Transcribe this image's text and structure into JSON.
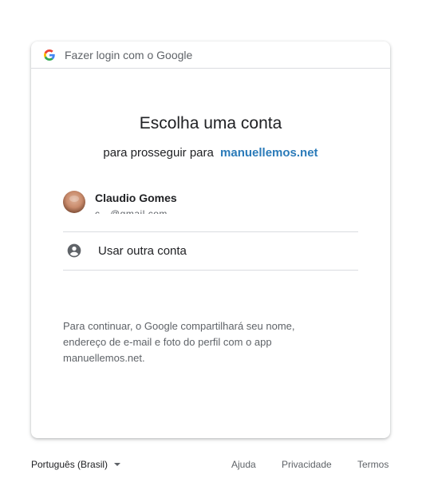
{
  "header": {
    "title": "Fazer login com o Google",
    "icon": "google-g-icon"
  },
  "main": {
    "title": "Escolha uma conta",
    "subtitle_prefix": "para prosseguir para",
    "subtitle_link": "manuellemos.net"
  },
  "accounts": [
    {
      "name": "Claudio Gomes",
      "email": "c…@gmail.com",
      "avatar": "user-avatar"
    }
  ],
  "other_account": {
    "label": "Usar outra conta",
    "icon": "account-circle-icon"
  },
  "info": {
    "text": "Para continuar, o Google compartilhará seu nome, endereço de e-mail e foto do perfil com o app manuellemos.net."
  },
  "footer": {
    "language": "Português (Brasil)",
    "help": "Ajuda",
    "privacy": "Privacidade",
    "terms": "Termos"
  },
  "colors": {
    "link": "#2b7bb9",
    "text": "#202124",
    "secondary": "#5f6368",
    "divider": "#dadce0"
  }
}
